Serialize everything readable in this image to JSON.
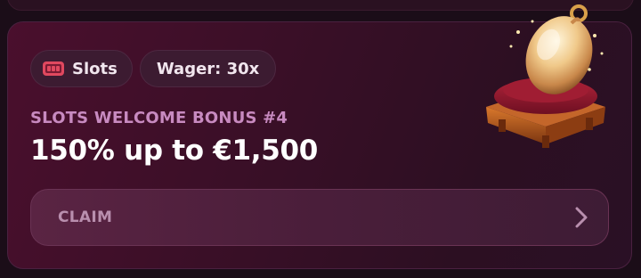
{
  "chips": {
    "category_label": "Slots",
    "wager_label": "Wager: 30x"
  },
  "bonus": {
    "subtitle": "SLOTS WELCOME BONUS #4",
    "headline": "150% up to €1,500"
  },
  "claim": {
    "label": "CLAIM"
  },
  "colors": {
    "background": "#1b0d18",
    "card": "#3a0f27",
    "subtitle": "#c88ac0",
    "headline": "#ffffff",
    "claim_text": "#b98fae",
    "slots_icon": "#e0485f"
  },
  "icons": {
    "category": "slot-machine-icon",
    "claim": "chevron-right-icon",
    "illustration": "golden-egg-on-cushion"
  }
}
